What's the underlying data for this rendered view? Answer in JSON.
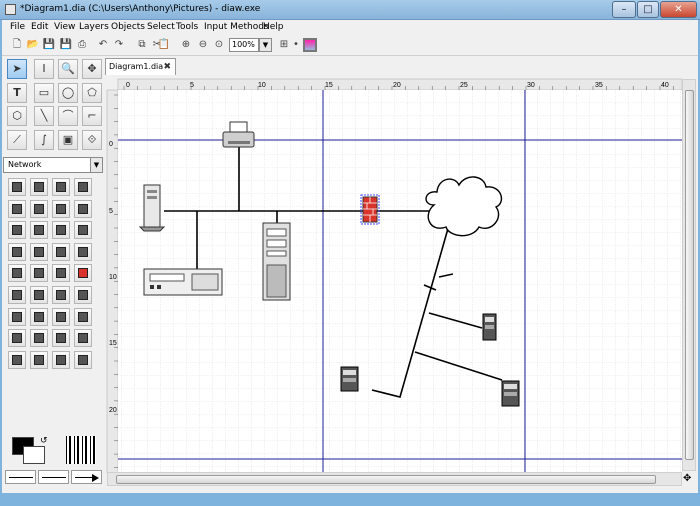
{
  "window": {
    "title": "*Diagram1.dia (C:\\Users\\Anthony\\Pictures) - diaw.exe"
  },
  "menu": [
    "File",
    "Edit",
    "View",
    "Layers",
    "Objects",
    "Select",
    "Tools",
    "Input Methods",
    "Help"
  ],
  "toolbar": {
    "zoom": "100%"
  },
  "sheet": {
    "selected": "Network"
  },
  "tab": {
    "label": "Diagram1.dia"
  },
  "ruler": {
    "h_labels": [
      "0",
      "5",
      "10",
      "15",
      "20",
      "25",
      "30",
      "35",
      "40"
    ],
    "v_labels": [
      "0",
      "5",
      "10",
      "15",
      "20"
    ]
  },
  "icons": {
    "tools": [
      "pointer",
      "text-edit",
      "zoom",
      "move",
      "text",
      "box",
      "ellipse",
      "polygon",
      "beziergon",
      "line",
      "arc",
      "zigzag",
      "polyline",
      "bezierline",
      "image",
      "outline"
    ],
    "shapes": [
      "computer",
      "monitor",
      "storage",
      "hub",
      "printer",
      "lightning",
      "bolt",
      "modem",
      "rack",
      "patch",
      "laptop",
      "bus",
      "antenna",
      "wifi",
      "cloud",
      "tower",
      "hexagon",
      "router",
      "switch",
      "firewall",
      "sun",
      "monitor2",
      "scanner",
      "flat",
      "laptop2",
      "pda",
      "handheld",
      "phone",
      "keyboard",
      "workstation",
      "desk",
      "cabinet",
      "cabinet2",
      "telephone",
      "chair",
      "bench"
    ]
  },
  "colors": {
    "grid_major": "#1d1d9a",
    "grid_minor": "#c9c9c9",
    "firewall": "#d9342b"
  }
}
